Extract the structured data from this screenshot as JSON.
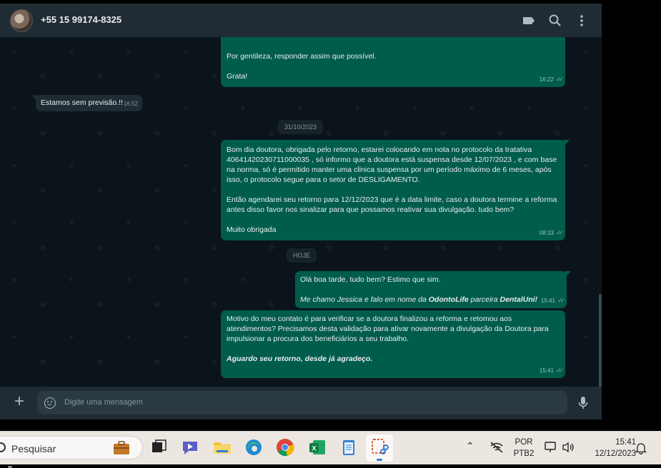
{
  "header": {
    "contact_name": "+55 15 99174-8325"
  },
  "messages": [
    {
      "text": "Por gentileza, responder assim que possível.\n\nGrata!",
      "time": "16:22"
    },
    {
      "text": "Estamos sem previsão.!!",
      "time": "16:52"
    },
    {
      "date_chip": "31/10/2023"
    },
    {
      "text": "Bom dia doutora, obrigada pelo retorno, estarei colocando em nota no protocolo da tratativa 4064142023071100003​5 , só informo que a doutora está suspensa desde 12/07/2023 , e com base na norma, só é permitido manter uma clinica suspensa por um período máximo de 6 meses, após isso, o protocolo segue para o setor de DESLIGAMENTO.\n\nEntão agendarei seu retorno para 12/12/2023 que é a data limite, caso a doutora termine a reforma antes disso favor nos sinalizar para que possamos reativar sua divulgação. tudo bem?\n\nMuito obrigada",
      "time": "08:33"
    },
    {
      "date_chip": "HOJE"
    },
    {
      "line1": "Olá boa tarde, tudo bem? Estimo que sim.",
      "line2_a": "Me chamo Jessica e falo em nome da ",
      "line2_b": "OdontoLife",
      "line2_c": " parceira ",
      "line2_d": "DentalUni!",
      "time": "15:41"
    },
    {
      "text": "Motivo do meu contato é para verificar se a doutora finalizou a reforma e retomou aos atendimentos? Precisamos desta validação para ativar novamente a divulgação da Doutora para impulsionar a procura dos beneficiários a seu trabalho.",
      "bold": "Aguardo seu retorno, desde já agradeço.",
      "time": "15:41"
    }
  ],
  "composer": {
    "placeholder": "Digite uma mensagem"
  },
  "taskbar": {
    "search_placeholder": "Pesquisar",
    "lang_line1": "POR",
    "lang_line2": "PTB2",
    "time": "15:41",
    "date": "12/12/2023"
  }
}
